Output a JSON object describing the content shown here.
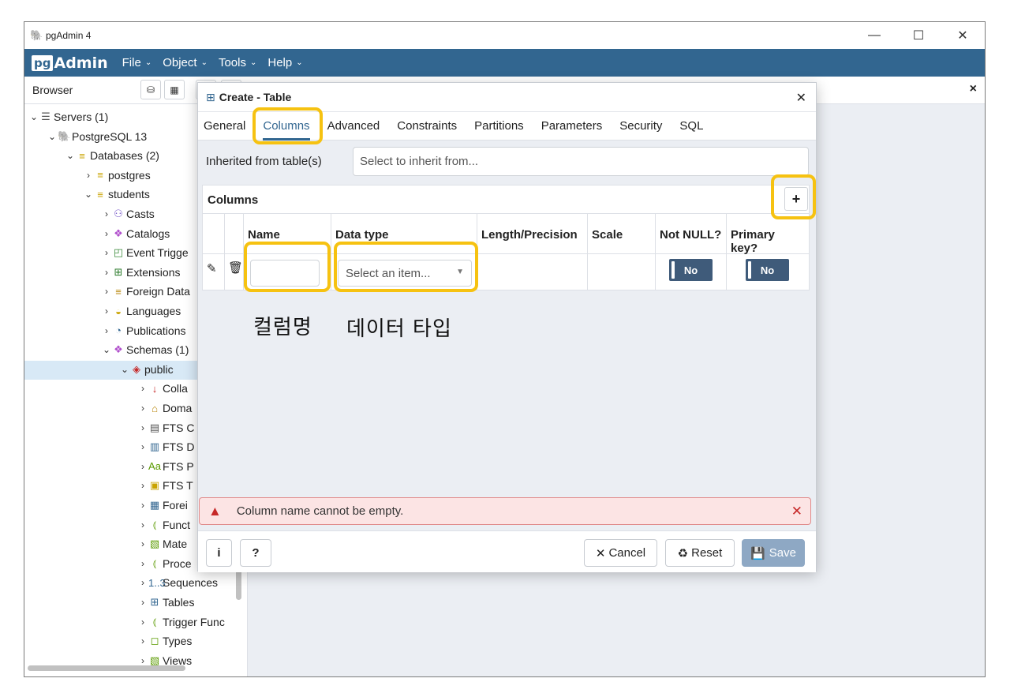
{
  "window": {
    "title": "pgAdmin 4",
    "minimize": "—",
    "maximize": "☐",
    "close": "✕"
  },
  "logo": {
    "pg": "pg",
    "admin": "Admin"
  },
  "menus": [
    "File",
    "Object",
    "Tools",
    "Help"
  ],
  "browser": {
    "label": "Browser",
    "close": "×"
  },
  "tree": [
    {
      "arrow": "⌄",
      "icon": "☰",
      "label": "Servers (1)"
    },
    {
      "arrow": "⌄",
      "icon": "🐘",
      "label": "PostgreSQL 13"
    },
    {
      "arrow": "⌄",
      "icon": "≡",
      "label": "Databases (2)"
    },
    {
      "arrow": "›",
      "icon": "≡",
      "label": "postgres"
    },
    {
      "arrow": "⌄",
      "icon": "≡",
      "label": "students"
    },
    {
      "arrow": "›",
      "icon": "⚇",
      "label": "Casts"
    },
    {
      "arrow": "›",
      "icon": "❖",
      "label": "Catalogs"
    },
    {
      "arrow": "›",
      "icon": "◰",
      "label": "Event Trigge"
    },
    {
      "arrow": "›",
      "icon": "⊞",
      "label": "Extensions"
    },
    {
      "arrow": "›",
      "icon": "≡",
      "label": "Foreign Data"
    },
    {
      "arrow": "›",
      "icon": "◒",
      "label": "Languages"
    },
    {
      "arrow": "›",
      "icon": "◔",
      "label": "Publications"
    },
    {
      "arrow": "⌄",
      "icon": "❖",
      "label": "Schemas (1)"
    },
    {
      "arrow": "⌄",
      "icon": "◈",
      "label": "public"
    },
    {
      "arrow": "›",
      "icon": "↓",
      "label": "Colla"
    },
    {
      "arrow": "›",
      "icon": "⌂",
      "label": "Doma"
    },
    {
      "arrow": "›",
      "icon": "▤",
      "label": "FTS C"
    },
    {
      "arrow": "›",
      "icon": "▥",
      "label": "FTS D"
    },
    {
      "arrow": "›",
      "icon": "Aa",
      "label": "FTS P"
    },
    {
      "arrow": "›",
      "icon": "▣",
      "label": "FTS T"
    },
    {
      "arrow": "›",
      "icon": "▦",
      "label": "Forei"
    },
    {
      "arrow": "›",
      "icon": "⦅",
      "label": "Funct"
    },
    {
      "arrow": "›",
      "icon": "▧",
      "label": "Mate"
    },
    {
      "arrow": "›",
      "icon": "⦅",
      "label": "Proce"
    },
    {
      "arrow": "›",
      "icon": "1..3",
      "label": "Sequences"
    },
    {
      "arrow": "›",
      "icon": "⊞",
      "label": "Tables"
    },
    {
      "arrow": "›",
      "icon": "⦅",
      "label": "Trigger Func"
    },
    {
      "arrow": "›",
      "icon": "◻",
      "label": "Types"
    },
    {
      "arrow": "›",
      "icon": "▧",
      "label": "Views"
    }
  ],
  "dialog": {
    "title": "Create - Table",
    "close": "✕",
    "tabs": [
      "General",
      "Columns",
      "Advanced",
      "Constraints",
      "Partitions",
      "Parameters",
      "Security",
      "SQL"
    ],
    "active_tab": "Columns",
    "inherit_label": "Inherited from table(s)",
    "inherit_placeholder": "Select to inherit from...",
    "columns_label": "Columns",
    "add_button": "+",
    "headers": [
      "Name",
      "Data type",
      "Length/Precision",
      "Scale",
      "Not NULL?",
      "Primary key?"
    ],
    "row": {
      "name": "",
      "datatype_placeholder": "Select an item...",
      "not_null": "No",
      "primary_key": "No"
    },
    "annotation_name": "컬럼명",
    "annotation_type": "데이터 타입",
    "error": "Column name cannot be empty.",
    "buttons": {
      "info": "i",
      "help": "?",
      "cancel": "Cancel",
      "reset": "Reset",
      "save": "Save"
    }
  },
  "colors": {
    "menubar": "#326690",
    "highlight": "#f6c211",
    "error_bg": "#fce4e4",
    "save_bg": "#8ea8c4"
  }
}
